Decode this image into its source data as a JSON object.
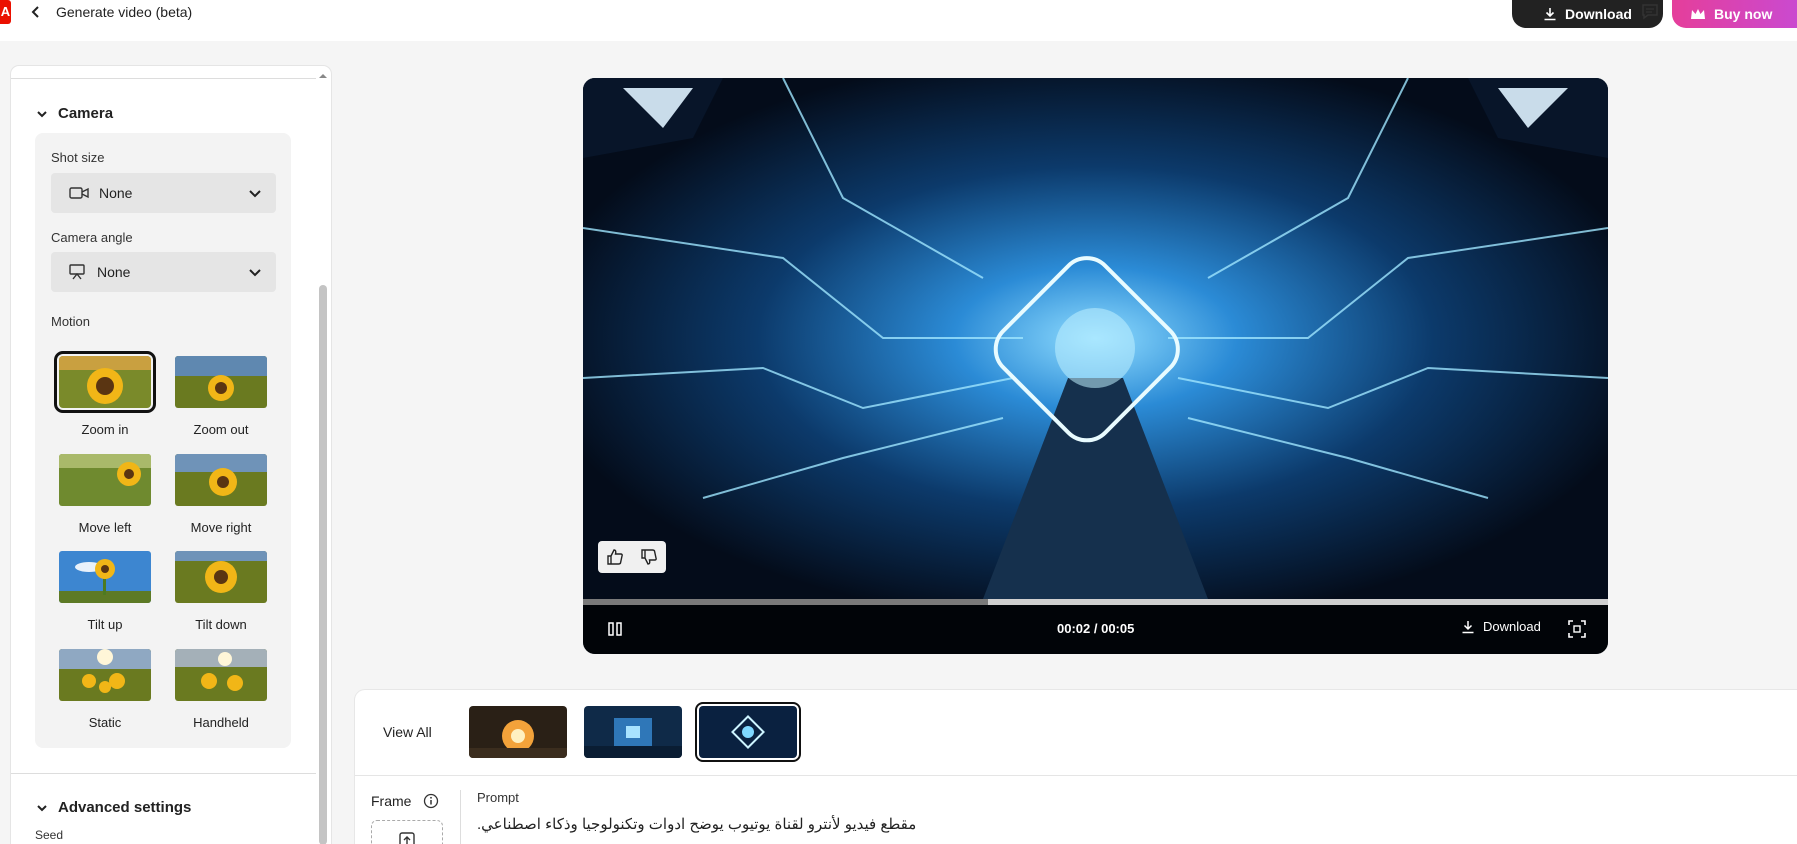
{
  "header": {
    "brand_letter": "A",
    "title": "Generate video (beta)",
    "download_label": "Download",
    "buy_label": "Buy now",
    "colors": {
      "brand": "#eb1000",
      "buy_gradient_start": "#e53e9a",
      "buy_gradient_end": "#c74bd6"
    }
  },
  "panel": {
    "camera_section": "Camera",
    "shot_size": {
      "label": "Shot size",
      "value": "None"
    },
    "camera_angle": {
      "label": "Camera angle",
      "value": "None"
    },
    "motion": {
      "label": "Motion",
      "items": [
        {
          "label": "Zoom in",
          "selected": true
        },
        {
          "label": "Zoom out",
          "selected": false
        },
        {
          "label": "Move left",
          "selected": false
        },
        {
          "label": "Move right",
          "selected": false
        },
        {
          "label": "Tilt up",
          "selected": false
        },
        {
          "label": "Tilt down",
          "selected": false
        },
        {
          "label": "Static",
          "selected": false
        },
        {
          "label": "Handheld",
          "selected": false
        }
      ]
    },
    "advanced_section": "Advanced settings",
    "seed_label": "Seed"
  },
  "video": {
    "time": "00:02 / 00:05",
    "progress": 0.395,
    "download_label": "Download"
  },
  "bottom": {
    "view_all": "View All",
    "frame_label": "Frame",
    "prompt_label": "Prompt",
    "prompt_text": "مقطع فيديو لأنترو لقناة يوتيوب يوضح ادوات وتكنولوجيا وذكاء اصطناعي."
  }
}
